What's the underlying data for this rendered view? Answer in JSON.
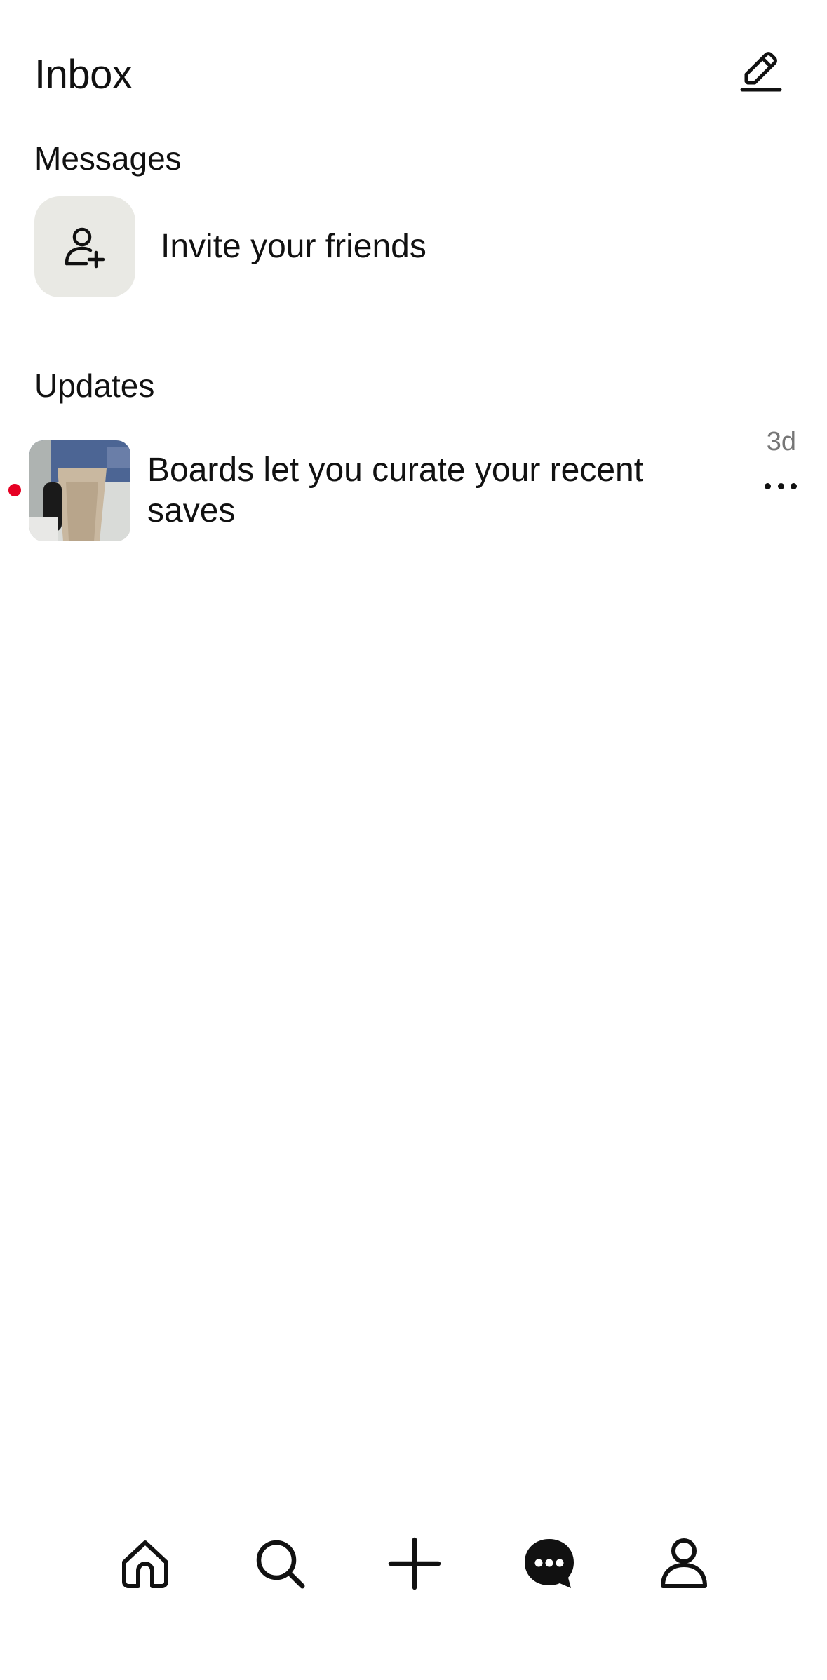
{
  "header": {
    "title": "Inbox",
    "compose_icon": "pencil-icon"
  },
  "messages": {
    "heading": "Messages",
    "invite_label": "Invite your friends",
    "invite_icon": "add-person-icon"
  },
  "updates": {
    "heading": "Updates",
    "items": [
      {
        "text": "Boards let you curate your recent saves",
        "time": "3d",
        "unread": true,
        "more_icon": "ellipsis-icon"
      }
    ]
  },
  "bottom_nav": {
    "items": [
      {
        "icon": "home-icon"
      },
      {
        "icon": "search-icon"
      },
      {
        "icon": "plus-icon"
      },
      {
        "icon": "chat-bubble-icon",
        "active": true
      },
      {
        "icon": "profile-icon"
      }
    ]
  },
  "colors": {
    "unread_dot": "#e60023",
    "invite_box": "#e9e9e4",
    "time_text": "#767676"
  }
}
